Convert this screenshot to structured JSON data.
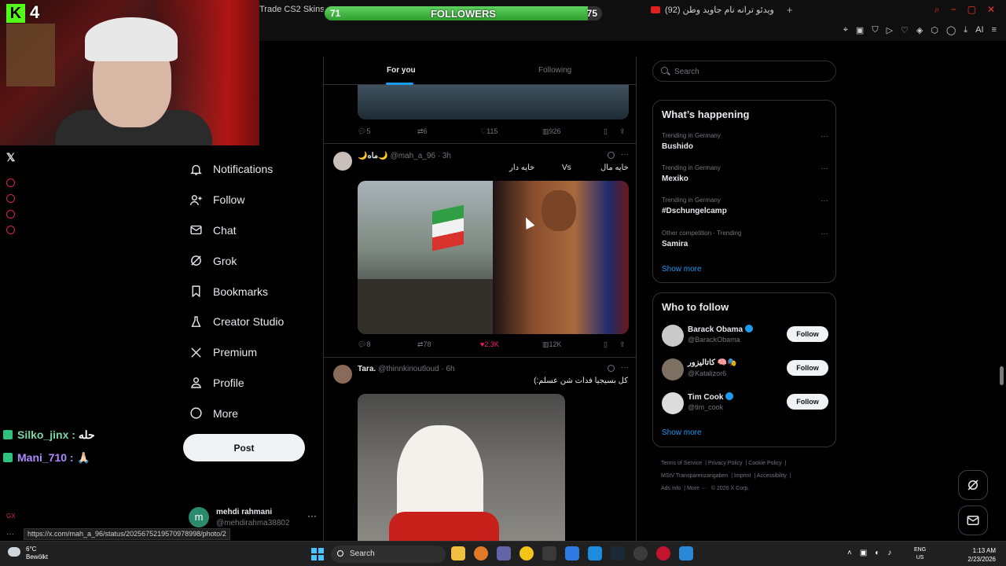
{
  "browser": {
    "tab_left_label": "Trade CS2 Skins | Be",
    "tab_right_label": "(92) ویدئو ترانه نام جاوید وطن",
    "toolbar_ai": "AI"
  },
  "stream_overlay": {
    "kick_count": "4",
    "followers_label": "FOLLOWERS",
    "followers_current": "71",
    "followers_goal": "75",
    "followers_progress": 0.95,
    "chat": [
      {
        "user": "Silko_jinx",
        "message": "حله"
      },
      {
        "user": "Mani_710",
        "message": "🙏🏻"
      }
    ]
  },
  "nav": {
    "items": [
      {
        "label": "Notifications",
        "icon": "bell-icon"
      },
      {
        "label": "Follow",
        "icon": "person-plus-icon"
      },
      {
        "label": "Chat",
        "icon": "envelope-icon"
      },
      {
        "label": "Grok",
        "icon": "grok-icon"
      },
      {
        "label": "Bookmarks",
        "icon": "bookmark-icon"
      },
      {
        "label": "Creator Studio",
        "icon": "flask-icon"
      },
      {
        "label": "Premium",
        "icon": "x-logo-icon"
      },
      {
        "label": "Profile",
        "icon": "person-icon"
      },
      {
        "label": "More",
        "icon": "more-circle-icon"
      }
    ],
    "post_label": "Post"
  },
  "account": {
    "initial": "m",
    "name": "mehdi rahmani",
    "handle": "@mehdirahma38802",
    "more": "···"
  },
  "status_url": "https://x.com/mah_a_96/status/2025675219570978998/photo/2",
  "feed": {
    "tabs": [
      "For you",
      "Following"
    ],
    "active_tab": "For you",
    "posts": [
      {
        "actions": {
          "replies": "5",
          "reposts": "6",
          "likes": "115",
          "views": "926"
        }
      },
      {
        "name": "🌙ماه🌙",
        "handle": "@mah_a_96 · 3h",
        "text_left": "خایه دار",
        "text_mid": "Vs",
        "text_right": "خایه مال",
        "actions": {
          "replies": "8",
          "reposts": "78",
          "likes": "2.3K",
          "views": "12K"
        }
      },
      {
        "name": "Tara.",
        "handle": "@thinnkinoutloud · 6h",
        "text": "کل بسیجیا فدات شن عسلم:)"
      }
    ]
  },
  "search": {
    "placeholder": "Search"
  },
  "trends": {
    "title": "What’s happening",
    "items": [
      {
        "meta": "Trending in Germany",
        "term": "Bushido"
      },
      {
        "meta": "Trending in Germany",
        "term": "Mexiko"
      },
      {
        "meta": "Trending in Germany",
        "term": "#Dschungelcamp"
      },
      {
        "meta": "Other competition · Trending",
        "term": "Samira"
      }
    ],
    "show_more": "Show more"
  },
  "who_to_follow": {
    "title": "Who to follow",
    "items": [
      {
        "name": "Barack Obama",
        "handle": "@BarackObama",
        "button": "Follow",
        "avatar_color": "#c9c9c9"
      },
      {
        "name": "کاتالیزور 🧠🎭",
        "handle": "@Katalizor6",
        "button": "Follow",
        "avatar_color": "#7d6f62"
      },
      {
        "name": "Tim Cook",
        "handle": "@tim_cook",
        "button": "Follow",
        "avatar_color": "#dcdcdc"
      }
    ],
    "show_more": "Show more"
  },
  "footer": {
    "links": [
      "Terms of Service",
      "Privacy Policy",
      "Cookie Policy",
      "MStV Transparenzangaben",
      "Imprint",
      "Accessibility",
      "Ads info",
      "More ···",
      "© 2026 X Corp."
    ]
  },
  "taskbar": {
    "weather_temp": "6°C",
    "weather_desc": "Bewölkt",
    "search_label": "Search",
    "lang_top": "ENG",
    "lang_bottom": "US",
    "time": "1:13 AM",
    "date": "2/23/2026"
  }
}
